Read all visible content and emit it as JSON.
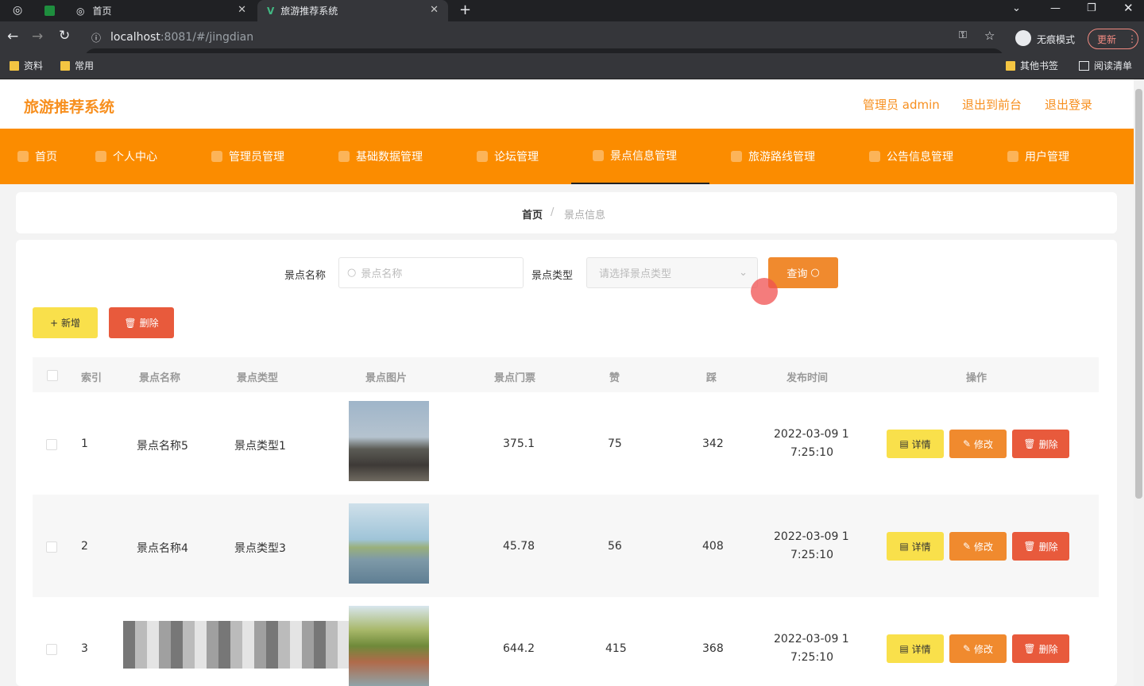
{
  "browser": {
    "tabs": [
      {
        "title": "首页"
      },
      {
        "title": "旅游推荐系统"
      }
    ],
    "url_host": "localhost",
    "url_rest": ":8081/#/jingdian",
    "incognito": "无痕模式",
    "update": "更新",
    "bookmarks": [
      "资料",
      "常用"
    ],
    "bookmarks_right": [
      "其他书签",
      "阅读清单"
    ]
  },
  "app": {
    "title": "旅游推荐系统",
    "links": [
      "管理员 admin",
      "退出到前台",
      "退出登录"
    ],
    "nav": [
      "首页",
      "个人中心",
      "管理员管理",
      "基础数据管理",
      "论坛管理",
      "景点信息管理",
      "旅游路线管理",
      "公告信息管理",
      "用户管理"
    ],
    "breadcrumb": [
      "首页",
      "景点信息"
    ],
    "search": {
      "name_label": "景点名称",
      "name_placeholder": "景点名称",
      "type_label": "景点类型",
      "type_placeholder": "请选择景点类型",
      "query": "查询"
    },
    "actions": {
      "add": "新增",
      "delete": "删除"
    },
    "columns": [
      "索引",
      "景点名称",
      "景点类型",
      "景点图片",
      "景点门票",
      "赞",
      "踩",
      "发布时间",
      "操作"
    ],
    "row_actions": {
      "detail": "详情",
      "edit": "修改",
      "delete": "删除"
    },
    "rows": [
      {
        "index": "1",
        "name": "景点名称5",
        "type": "景点类型1",
        "ticket": "375.1",
        "up": "75",
        "down": "342",
        "time1": "2022-03-09 1",
        "time2": "7:25:10"
      },
      {
        "index": "2",
        "name": "景点名称4",
        "type": "景点类型3",
        "ticket": "45.78",
        "up": "56",
        "down": "408",
        "time1": "2022-03-09 1",
        "time2": "7:25:10"
      },
      {
        "index": "3",
        "name": "",
        "type": "",
        "ticket": "644.2",
        "up": "415",
        "down": "368",
        "time1": "2022-03-09 1",
        "time2": "7:25:10"
      }
    ]
  },
  "colors": {
    "accent": "#fb8c00",
    "title": "#f78f1e",
    "yellow": "#f9e04b",
    "orange": "#f08a2e",
    "red": "#e85a3c"
  }
}
